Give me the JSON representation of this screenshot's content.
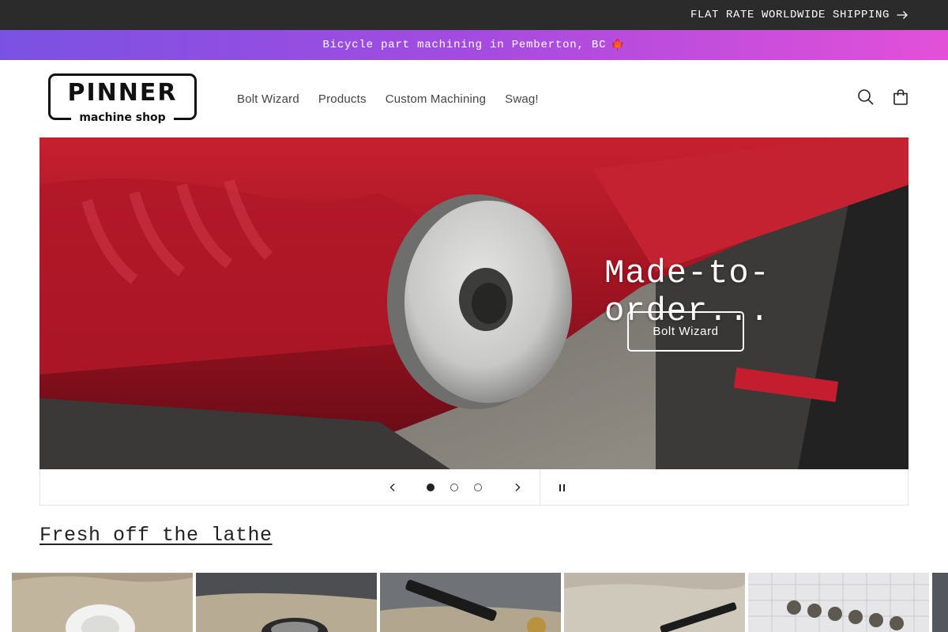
{
  "topbar": {
    "shipping_text": "FLAT RATE WORLDWIDE SHIPPING"
  },
  "promo": {
    "text": "Bicycle part machining in Pemberton, BC",
    "emoji": "🍁"
  },
  "header": {
    "logo": {
      "word": "PINNER",
      "sub": "machine shop"
    },
    "nav": [
      "Bolt Wizard",
      "Products",
      "Custom Machining",
      "Swag!"
    ],
    "icons": {
      "search": "search-icon",
      "cart": "cart-icon"
    }
  },
  "hero": {
    "heading": "Made-to-order...",
    "button_label": "Bolt Wizard",
    "slide_count": 3,
    "active_slide": 1
  },
  "featured": {
    "title": "Fresh off the lathe",
    "product_cards": 6
  },
  "colors": {
    "topbar_bg": "#2b2b2b",
    "promo_gradient_start": "#7a52e3",
    "promo_gradient_end": "#e350d8",
    "hero_red": "#b71a2a"
  }
}
